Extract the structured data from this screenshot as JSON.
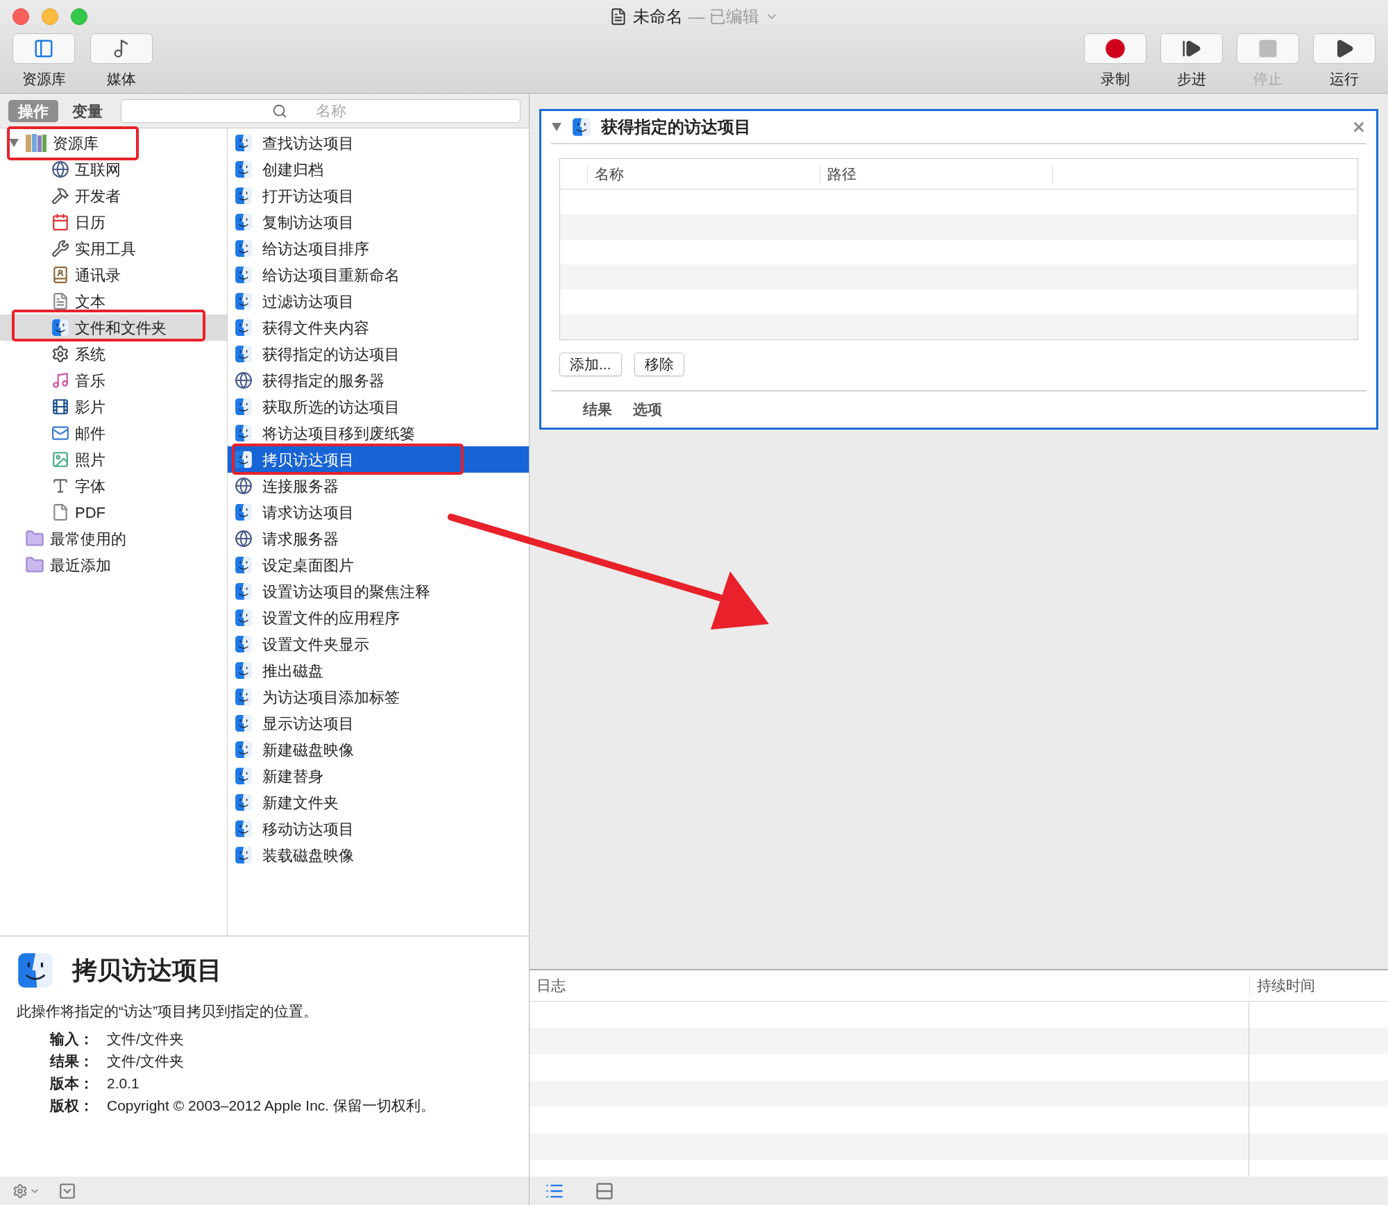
{
  "window": {
    "title": "未命名",
    "status": "— 已编辑"
  },
  "toolbar_left": [
    {
      "label": "资源库"
    },
    {
      "label": "媒体"
    }
  ],
  "toolbar_right": [
    {
      "label": "录制",
      "kind": "record",
      "disabled": false
    },
    {
      "label": "步进",
      "kind": "step",
      "disabled": false
    },
    {
      "label": "停止",
      "kind": "stop",
      "disabled": true
    },
    {
      "label": "运行",
      "kind": "run",
      "disabled": false
    }
  ],
  "library_tabs": [
    {
      "label": "操作",
      "selected": true
    },
    {
      "label": "变量",
      "selected": false
    }
  ],
  "search": {
    "placeholder": "名称"
  },
  "library": [
    {
      "label": "资源库",
      "expanded": true,
      "selected": false,
      "children": [
        {
          "label": "互联网",
          "selected": false
        },
        {
          "label": "开发者",
          "selected": false
        },
        {
          "label": "日历",
          "selected": false
        },
        {
          "label": "实用工具",
          "selected": false
        },
        {
          "label": "通讯录",
          "selected": false
        },
        {
          "label": "文本",
          "selected": false
        },
        {
          "label": "文件和文件夹",
          "selected": true
        },
        {
          "label": "系统",
          "selected": false
        },
        {
          "label": "音乐",
          "selected": false
        },
        {
          "label": "影片",
          "selected": false
        },
        {
          "label": "邮件",
          "selected": false
        },
        {
          "label": "照片",
          "selected": false
        },
        {
          "label": "字体",
          "selected": false
        },
        {
          "label": "PDF",
          "selected": false
        }
      ]
    },
    {
      "label": "最常使用的",
      "selected": false
    },
    {
      "label": "最近添加",
      "selected": false
    }
  ],
  "actions": [
    {
      "label": "查找访达项目",
      "kind": "finder",
      "selected": false
    },
    {
      "label": "创建归档",
      "kind": "finder",
      "selected": false
    },
    {
      "label": "打开访达项目",
      "kind": "finder",
      "selected": false
    },
    {
      "label": "复制访达项目",
      "kind": "finder",
      "selected": false
    },
    {
      "label": "给访达项目排序",
      "kind": "finder",
      "selected": false
    },
    {
      "label": "给访达项目重新命名",
      "kind": "finder",
      "selected": false
    },
    {
      "label": "过滤访达项目",
      "kind": "finder",
      "selected": false
    },
    {
      "label": "获得文件夹内容",
      "kind": "finder",
      "selected": false
    },
    {
      "label": "获得指定的访达项目",
      "kind": "finder",
      "selected": false
    },
    {
      "label": "获得指定的服务器",
      "kind": "server",
      "selected": false
    },
    {
      "label": "获取所选的访达项目",
      "kind": "finder",
      "selected": false
    },
    {
      "label": "将访达项目移到废纸篓",
      "kind": "finder",
      "selected": false
    },
    {
      "label": "拷贝访达项目",
      "kind": "finder",
      "selected": true
    },
    {
      "label": "连接服务器",
      "kind": "server",
      "selected": false
    },
    {
      "label": "请求访达项目",
      "kind": "finder",
      "selected": false
    },
    {
      "label": "请求服务器",
      "kind": "server",
      "selected": false
    },
    {
      "label": "设定桌面图片",
      "kind": "finder",
      "selected": false
    },
    {
      "label": "设置访达项目的聚焦注释",
      "kind": "finder",
      "selected": false
    },
    {
      "label": "设置文件的应用程序",
      "kind": "finder",
      "selected": false
    },
    {
      "label": "设置文件夹显示",
      "kind": "finder",
      "selected": false
    },
    {
      "label": "推出磁盘",
      "kind": "finder",
      "selected": false
    },
    {
      "label": "为访达项目添加标签",
      "kind": "finder",
      "selected": false
    },
    {
      "label": "显示访达项目",
      "kind": "finder",
      "selected": false
    },
    {
      "label": "新建磁盘映像",
      "kind": "finder",
      "selected": false
    },
    {
      "label": "新建替身",
      "kind": "finder",
      "selected": false
    },
    {
      "label": "新建文件夹",
      "kind": "finder",
      "selected": false
    },
    {
      "label": "移动访达项目",
      "kind": "finder",
      "selected": false
    },
    {
      "label": "装载磁盘映像",
      "kind": "finder",
      "selected": false
    }
  ],
  "description": {
    "title": "拷贝访达项目",
    "text": "此操作将指定的“访达”项目拷贝到指定的位置。",
    "fields": [
      {
        "label": "输入：",
        "value": "文件/文件夹"
      },
      {
        "label": "结果：",
        "value": "文件/文件夹"
      },
      {
        "label": "版本：",
        "value": "2.0.1"
      },
      {
        "label": "版权：",
        "value": "Copyright © 2003–2012 Apple Inc. 保留一切权利。"
      }
    ]
  },
  "workflow_action": {
    "title": "获得指定的访达项目",
    "expanded": true,
    "columns": [
      "名称",
      "路径"
    ],
    "buttons": [
      "添加...",
      "移除"
    ],
    "tabs": [
      "结果",
      "选项"
    ]
  },
  "log": {
    "columns": [
      "日志",
      "持续时间"
    ]
  }
}
